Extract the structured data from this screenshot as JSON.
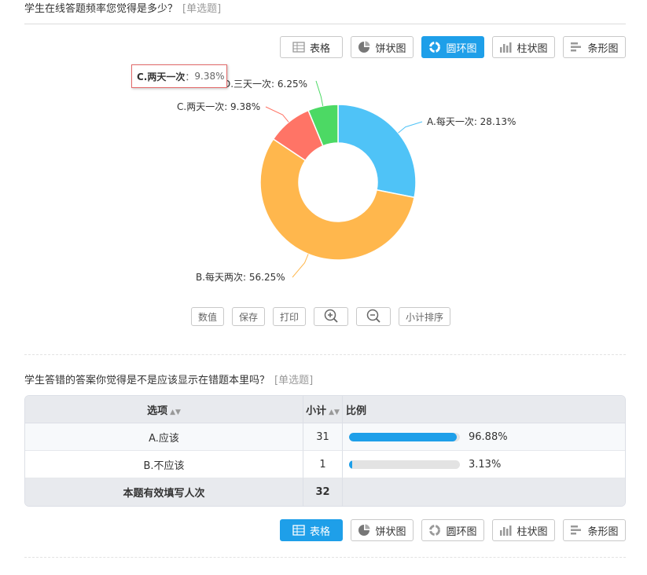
{
  "question1": {
    "title": "学生在线答题频率您觉得是多少？",
    "type": "[单选题]",
    "view_buttons": [
      {
        "label": "表格",
        "icon": "table-icon",
        "active": false
      },
      {
        "label": "饼状图",
        "icon": "pie-icon",
        "active": false
      },
      {
        "label": "圆环图",
        "icon": "donut-icon",
        "active": true
      },
      {
        "label": "柱状图",
        "icon": "bar-chart-icon",
        "active": false
      },
      {
        "label": "条形图",
        "icon": "hbar-chart-icon",
        "active": false
      }
    ],
    "tooltip": {
      "name": "C.两天一次",
      "sep": "：",
      "value": "9.38%"
    },
    "tools": [
      "数值",
      "保存",
      "打印",
      "小计排序"
    ]
  },
  "chart_data": {
    "type": "pie",
    "variant": "donut",
    "slices": [
      {
        "label": "A.每天一次: 28.13%",
        "value": 28.13,
        "color": "#4fc3f7"
      },
      {
        "label": "B.每天两次: 56.25%",
        "value": 56.25,
        "color": "#ffb74d"
      },
      {
        "label": "C.两天一次: 9.38%",
        "value": 9.38,
        "color": "#ff7466"
      },
      {
        "label": "D.三天一次: 6.25%",
        "value": 6.25,
        "color": "#4cd964"
      }
    ]
  },
  "question2": {
    "title": "学生答错的答案你觉得是不是应该显示在错题本里吗？",
    "type": "[单选题]",
    "headers": {
      "option": "选项",
      "count": "小计",
      "ratio": "比例"
    },
    "rows": [
      {
        "option": "A.应该",
        "count": "31",
        "pct": "96.88%",
        "fraction": 0.9688
      },
      {
        "option": "B.不应该",
        "count": "1",
        "pct": "3.13%",
        "fraction": 0.0313
      }
    ],
    "footer": {
      "label": "本题有效填写人次",
      "total": "32"
    },
    "view_buttons": [
      {
        "label": "表格",
        "icon": "table-icon",
        "active": true
      },
      {
        "label": "饼状图",
        "icon": "pie-icon",
        "active": false
      },
      {
        "label": "圆环图",
        "icon": "donut-icon",
        "active": false
      },
      {
        "label": "柱状图",
        "icon": "bar-chart-icon",
        "active": false
      },
      {
        "label": "条形图",
        "icon": "hbar-chart-icon",
        "active": false
      }
    ]
  },
  "colors": {
    "accent": "#1e9fe9"
  }
}
